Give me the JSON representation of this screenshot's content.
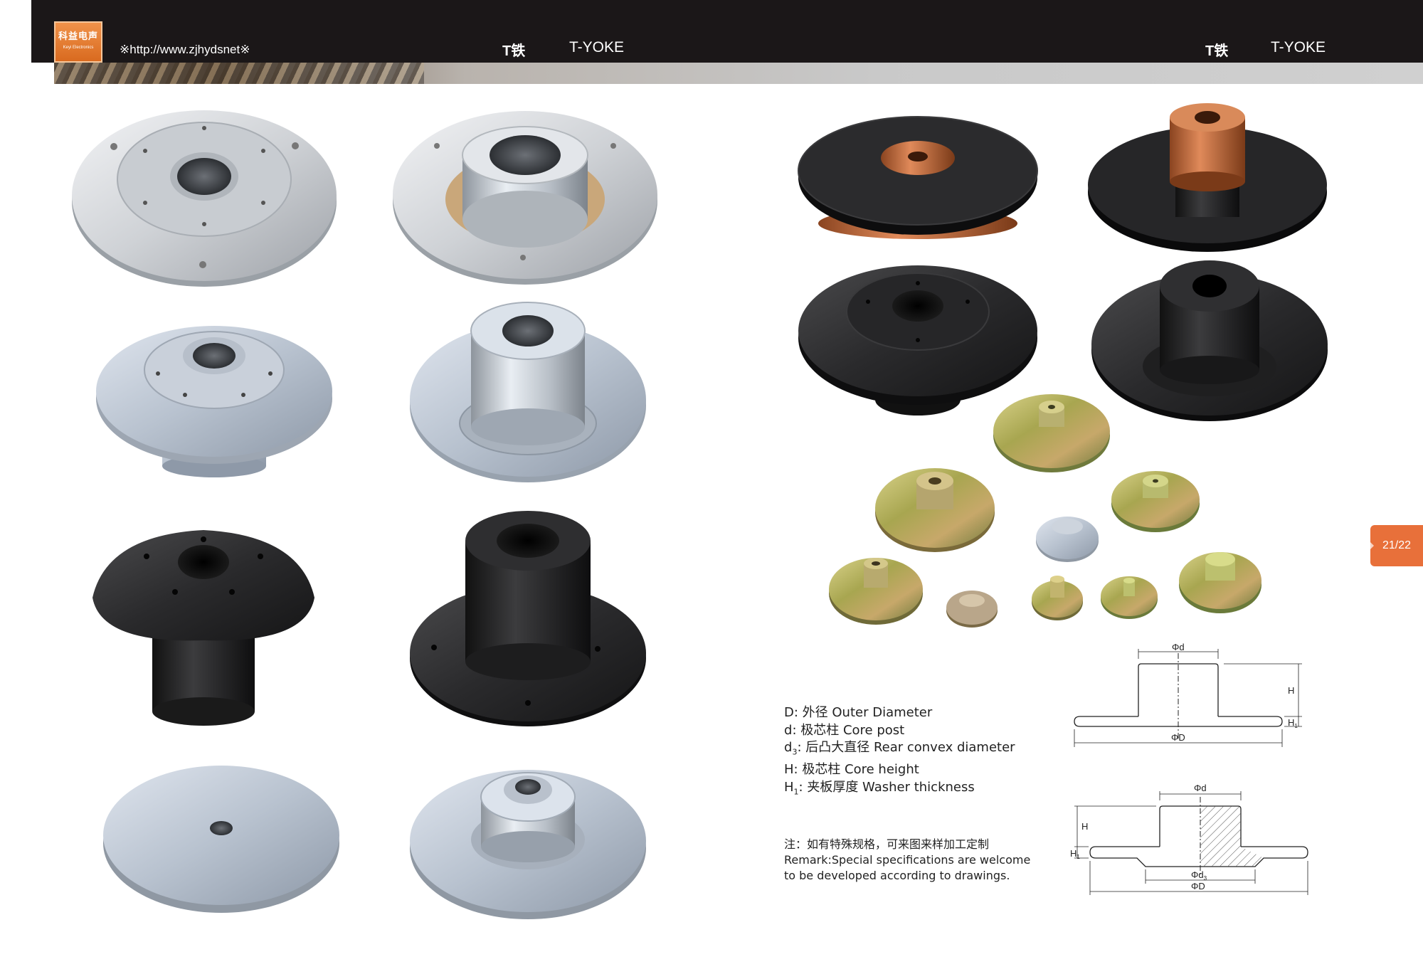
{
  "header": {
    "logo_cn": "科益电声",
    "logo_en": "Keyi Electronics",
    "url": "※http://www.zjhydsnet※",
    "left_title_zh": "T铁",
    "left_title_en": "T-YOKE",
    "right_title_zh": "T铁",
    "right_title_en": "T-YOKE"
  },
  "page_tab": "21/22",
  "legend": {
    "items": [
      {
        "symbol": "D",
        "sub": "",
        "text": ": 外径 Outer Diameter"
      },
      {
        "symbol": "d",
        "sub": "",
        "text": ": 极芯柱 Core post"
      },
      {
        "symbol": "d",
        "sub": "3",
        "text": ": 后凸大直径 Rear convex diameter"
      },
      {
        "symbol": "H",
        "sub": "",
        "text": ": 极芯柱 Core height"
      },
      {
        "symbol": "H",
        "sub": "1",
        "text": ": 夹板厚度 Washer thickness"
      }
    ]
  },
  "note": {
    "zh": "注：如有特殊规格，可来图来样加工定制",
    "en_line1": "Remark:Special specifications are welcome",
    "en_line2": "to be developed according to drawings."
  },
  "diagram_top": {
    "d": "Φd",
    "H": "H",
    "H1": "H",
    "H1sub": "1",
    "D": "ΦD"
  },
  "diagram_bottom": {
    "d": "Φd",
    "H": "H",
    "H1": "H",
    "H1sub": "1",
    "d3": "Φd",
    "d3sub": "3",
    "D": "ΦD"
  },
  "products": [
    {
      "name": "silver-flat-plate-with-holes",
      "finish": "silver"
    },
    {
      "name": "silver-plate-with-core",
      "finish": "silver"
    },
    {
      "name": "silver-stepped-yoke",
      "finish": "zinc"
    },
    {
      "name": "silver-tall-core-yoke",
      "finish": "zinc"
    },
    {
      "name": "black-flared-yoke",
      "finish": "black"
    },
    {
      "name": "black-tall-core-yoke",
      "finish": "black"
    },
    {
      "name": "silver-disc",
      "finish": "zinc"
    },
    {
      "name": "silver-disc-with-core",
      "finish": "zinc"
    },
    {
      "name": "black-patterned-disc-copper-core",
      "finish": "black"
    },
    {
      "name": "black-disc-copper-core",
      "finish": "black"
    },
    {
      "name": "black-recessed-yoke",
      "finish": "black"
    },
    {
      "name": "black-core-yoke",
      "finish": "black"
    },
    {
      "name": "small-brass-yokes",
      "finish": "yellow-zinc"
    }
  ],
  "colors": {
    "accent": "#e8703a",
    "topbar": "#1b1718"
  }
}
